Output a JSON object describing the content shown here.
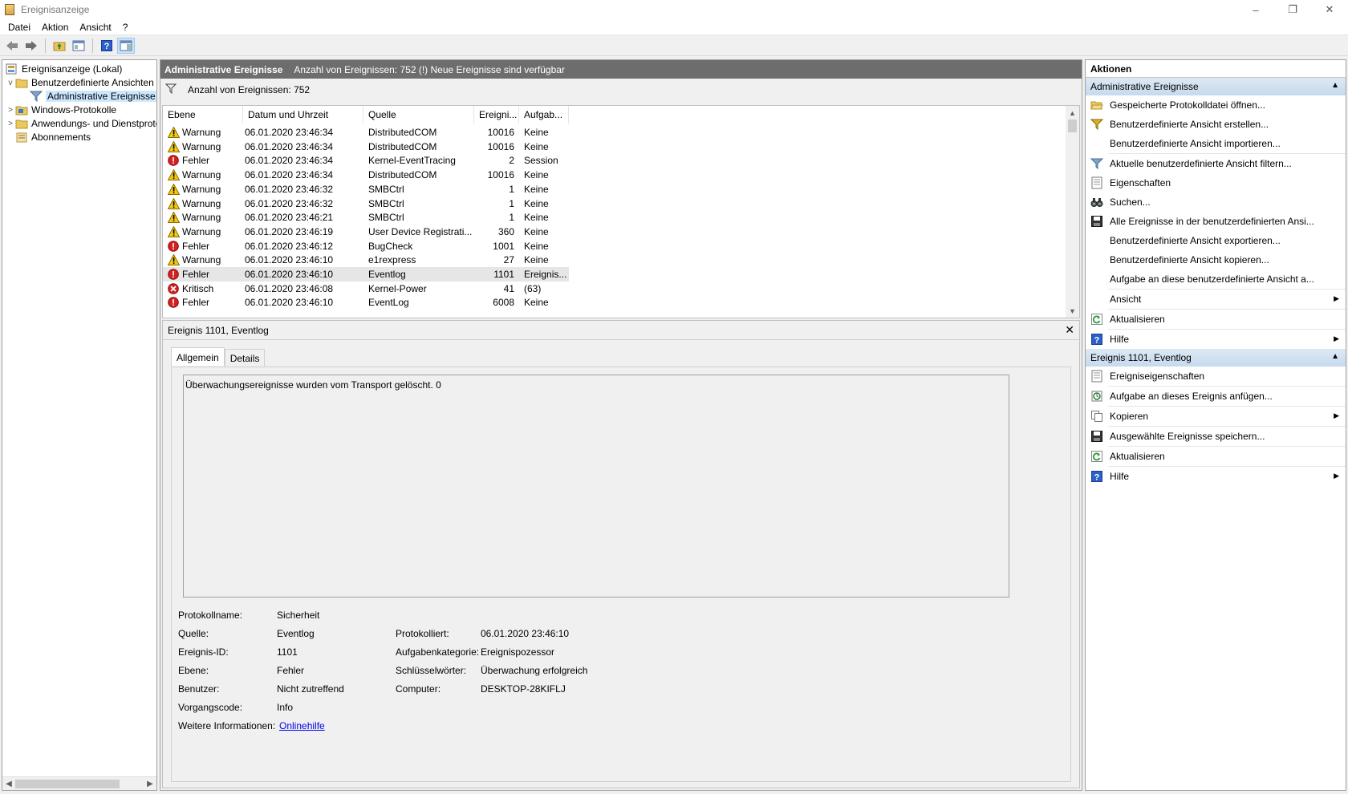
{
  "window": {
    "title": "Ereignisanzeige",
    "minimize": "–",
    "restore": "❐",
    "close": "✕"
  },
  "menu": [
    "Datei",
    "Aktion",
    "Ansicht",
    "?"
  ],
  "tree": {
    "items": [
      {
        "label": "Ereignisanzeige (Lokal)",
        "expander": "",
        "level": 0,
        "icon": "computer-icon"
      },
      {
        "label": "Benutzerdefinierte Ansichten",
        "expander": "v",
        "level": 1,
        "icon": "folder-icon"
      },
      {
        "label": "Administrative Ereignisse",
        "expander": "",
        "level": 2,
        "icon": "filter-icon",
        "selected": true
      },
      {
        "label": "Windows-Protokolle",
        "expander": ">",
        "level": 1,
        "icon": "folder-icon"
      },
      {
        "label": "Anwendungs- und Dienstprotokolle",
        "expander": ">",
        "level": 1,
        "icon": "folder-icon"
      },
      {
        "label": "Abonnements",
        "expander": "",
        "level": 1,
        "icon": "folder-icon"
      }
    ]
  },
  "middle": {
    "header_title": "Administrative Ereignisse",
    "header_info": "Anzahl von Ereignissen: 752 (!) Neue Ereignisse sind verfügbar",
    "filter_label": "Anzahl von Ereignissen: 752",
    "columns": [
      "Ebene",
      "Datum und Uhrzeit",
      "Quelle",
      "Ereigni...",
      "Aufgab..."
    ],
    "rows": [
      {
        "level": "Warnung",
        "icon": "warning-icon",
        "date": "06.01.2020 23:46:34",
        "source": "DistributedCOM",
        "id": "10016",
        "task": "Keine"
      },
      {
        "level": "Warnung",
        "icon": "warning-icon",
        "date": "06.01.2020 23:46:34",
        "source": "DistributedCOM",
        "id": "10016",
        "task": "Keine"
      },
      {
        "level": "Fehler",
        "icon": "error-icon",
        "date": "06.01.2020 23:46:34",
        "source": "Kernel-EventTracing",
        "id": "2",
        "task": "Session"
      },
      {
        "level": "Warnung",
        "icon": "warning-icon",
        "date": "06.01.2020 23:46:34",
        "source": "DistributedCOM",
        "id": "10016",
        "task": "Keine"
      },
      {
        "level": "Warnung",
        "icon": "warning-icon",
        "date": "06.01.2020 23:46:32",
        "source": "SMBCtrl",
        "id": "1",
        "task": "Keine"
      },
      {
        "level": "Warnung",
        "icon": "warning-icon",
        "date": "06.01.2020 23:46:32",
        "source": "SMBCtrl",
        "id": "1",
        "task": "Keine"
      },
      {
        "level": "Warnung",
        "icon": "warning-icon",
        "date": "06.01.2020 23:46:21",
        "source": "SMBCtrl",
        "id": "1",
        "task": "Keine"
      },
      {
        "level": "Warnung",
        "icon": "warning-icon",
        "date": "06.01.2020 23:46:19",
        "source": "User Device Registrati...",
        "id": "360",
        "task": "Keine"
      },
      {
        "level": "Fehler",
        "icon": "error-icon",
        "date": "06.01.2020 23:46:12",
        "source": "BugCheck",
        "id": "1001",
        "task": "Keine"
      },
      {
        "level": "Warnung",
        "icon": "warning-icon",
        "date": "06.01.2020 23:46:10",
        "source": "e1rexpress",
        "id": "27",
        "task": "Keine"
      },
      {
        "level": "Fehler",
        "icon": "error-icon",
        "date": "06.01.2020 23:46:10",
        "source": "Eventlog",
        "id": "1101",
        "task": "Ereignis...",
        "selected": true
      },
      {
        "level": "Kritisch",
        "icon": "critical-icon",
        "date": "06.01.2020 23:46:08",
        "source": "Kernel-Power",
        "id": "41",
        "task": "(63)"
      },
      {
        "level": "Fehler",
        "icon": "error-icon",
        "date": "06.01.2020 23:46:10",
        "source": "EventLog",
        "id": "6008",
        "task": "Keine"
      }
    ]
  },
  "detail": {
    "title": "Ereignis 1101, Eventlog",
    "close": "✕",
    "tabs": [
      "Allgemein",
      "Details"
    ],
    "description": "Überwachungsereignisse wurden vom Transport gelöscht. 0",
    "props_left": [
      {
        "label": "Protokollname:",
        "value": "Sicherheit"
      },
      {
        "label": "Quelle:",
        "value": "Eventlog"
      },
      {
        "label": "Ereignis-ID:",
        "value": "1101"
      },
      {
        "label": "Ebene:",
        "value": "Fehler"
      },
      {
        "label": "Benutzer:",
        "value": "Nicht zutreffend"
      },
      {
        "label": "Vorgangscode:",
        "value": "Info"
      },
      {
        "label": "Weitere Informationen:",
        "value": "Onlinehilfe"
      }
    ],
    "props_right": [
      {
        "label": "Protokolliert:",
        "value": "06.01.2020 23:46:10"
      },
      {
        "label": "Aufgabenkategorie:",
        "value": "Ereignispozessor"
      },
      {
        "label": "Schlüsselwörter:",
        "value": "Überwachung erfolgreich"
      },
      {
        "label": "Computer:",
        "value": "DESKTOP-28KIFLJ"
      }
    ]
  },
  "actions": {
    "title": "Aktionen",
    "section1": {
      "title": "Administrative Ereignisse",
      "items": [
        {
          "label": "Gespeicherte Protokolldatei öffnen...",
          "icon": "open-folder-icon"
        },
        {
          "label": "Benutzerdefinierte Ansicht erstellen...",
          "icon": "filter-create-icon"
        },
        {
          "label": "Benutzerdefinierte Ansicht importieren...",
          "icon": ""
        },
        {
          "label": "Aktuelle benutzerdefinierte Ansicht filtern...",
          "icon": "filter-icon"
        },
        {
          "label": "Eigenschaften",
          "icon": "properties-icon"
        },
        {
          "label": "Suchen...",
          "icon": "binoculars-icon"
        },
        {
          "label": "Alle Ereignisse in der benutzerdefinierten Ansi...",
          "icon": "save-icon"
        },
        {
          "label": "Benutzerdefinierte Ansicht exportieren...",
          "icon": ""
        },
        {
          "label": "Benutzerdefinierte Ansicht kopieren...",
          "icon": ""
        },
        {
          "label": "Aufgabe an diese benutzerdefinierte Ansicht a...",
          "icon": ""
        },
        {
          "label": "Ansicht",
          "icon": "",
          "submenu": true
        },
        {
          "label": "Aktualisieren",
          "icon": "refresh-icon"
        },
        {
          "label": "Hilfe",
          "icon": "help-icon",
          "submenu": true
        }
      ]
    },
    "section2": {
      "title": "Ereignis 1101, Eventlog",
      "items": [
        {
          "label": "Ereigniseigenschaften",
          "icon": "properties-icon"
        },
        {
          "label": "Aufgabe an dieses Ereignis anfügen...",
          "icon": "task-icon"
        },
        {
          "label": "Kopieren",
          "icon": "copy-icon",
          "submenu": true
        },
        {
          "label": "Ausgewählte Ereignisse speichern...",
          "icon": "save-icon"
        },
        {
          "label": "Aktualisieren",
          "icon": "refresh-icon"
        },
        {
          "label": "Hilfe",
          "icon": "help-icon",
          "submenu": true
        }
      ]
    }
  }
}
